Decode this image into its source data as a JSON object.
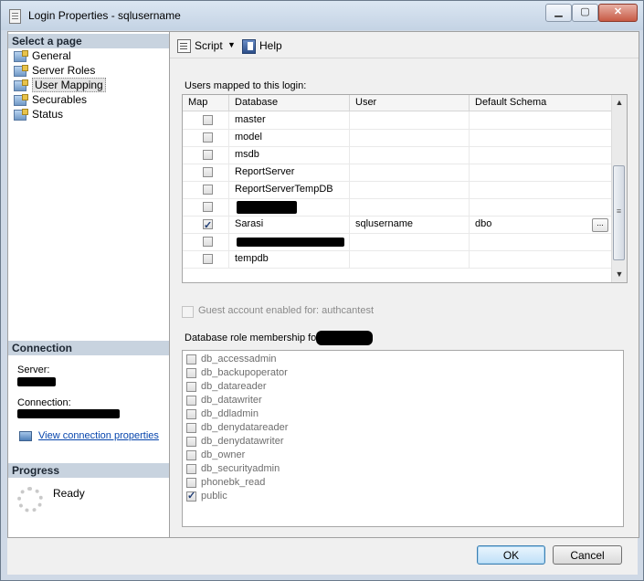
{
  "window": {
    "title": "Login Properties - sqlusername",
    "controls": [
      "minimize-icon",
      "maximize-icon",
      "close-icon"
    ],
    "accent": "#c4d3e4"
  },
  "left_pane": {
    "select_page_header": "Select a page",
    "pages": [
      {
        "label": "General",
        "selected": false
      },
      {
        "label": "Server Roles",
        "selected": false
      },
      {
        "label": "User Mapping",
        "selected": true
      },
      {
        "label": "Securables",
        "selected": false
      },
      {
        "label": "Status",
        "selected": false
      }
    ],
    "connection": {
      "header": "Connection",
      "server_label": "Server:",
      "connection_label": "Connection:",
      "link": "View connection properties"
    },
    "progress": {
      "header": "Progress",
      "status": "Ready"
    }
  },
  "toolbar": {
    "script_label": "Script",
    "help_label": "Help"
  },
  "users_mapped": {
    "label": "Users mapped to this login:",
    "columns": [
      "Map",
      "Database",
      "User",
      "Default Schema"
    ],
    "rows": [
      {
        "map": false,
        "database": "master",
        "user": "",
        "schema": "",
        "redacted": false
      },
      {
        "map": false,
        "database": "model",
        "user": "",
        "schema": "",
        "redacted": false
      },
      {
        "map": false,
        "database": "msdb",
        "user": "",
        "schema": "",
        "redacted": false
      },
      {
        "map": false,
        "database": "ReportServer",
        "user": "",
        "schema": "",
        "redacted": false
      },
      {
        "map": false,
        "database": "ReportServerTempDB",
        "user": "",
        "schema": "",
        "redacted": false
      },
      {
        "map": false,
        "database": "",
        "user": "",
        "schema": "",
        "redacted": true
      },
      {
        "map": true,
        "database": "Sarasi",
        "user": "sqlusername",
        "schema": "dbo",
        "redacted": false
      },
      {
        "map": false,
        "database": "",
        "user": "",
        "schema": "",
        "redacted": true
      },
      {
        "map": false,
        "database": "tempdb",
        "user": "",
        "schema": "",
        "redacted": false
      }
    ],
    "browse_button": "...",
    "scrollbar_grip": "≡"
  },
  "guest": {
    "label": "Guest account enabled for: authcantest",
    "checked": false
  },
  "role_membership": {
    "label": "Database role membership for:",
    "roles": [
      {
        "name": "db_accessadmin",
        "checked": false
      },
      {
        "name": "db_backupoperator",
        "checked": false
      },
      {
        "name": "db_datareader",
        "checked": false
      },
      {
        "name": "db_datawriter",
        "checked": false
      },
      {
        "name": "db_ddladmin",
        "checked": false
      },
      {
        "name": "db_denydatareader",
        "checked": false
      },
      {
        "name": "db_denydatawriter",
        "checked": false
      },
      {
        "name": "db_owner",
        "checked": false
      },
      {
        "name": "db_securityadmin",
        "checked": false
      },
      {
        "name": "phonebk_read",
        "checked": false
      },
      {
        "name": "public",
        "checked": true
      }
    ]
  },
  "buttons": {
    "ok": "OK",
    "cancel": "Cancel"
  }
}
